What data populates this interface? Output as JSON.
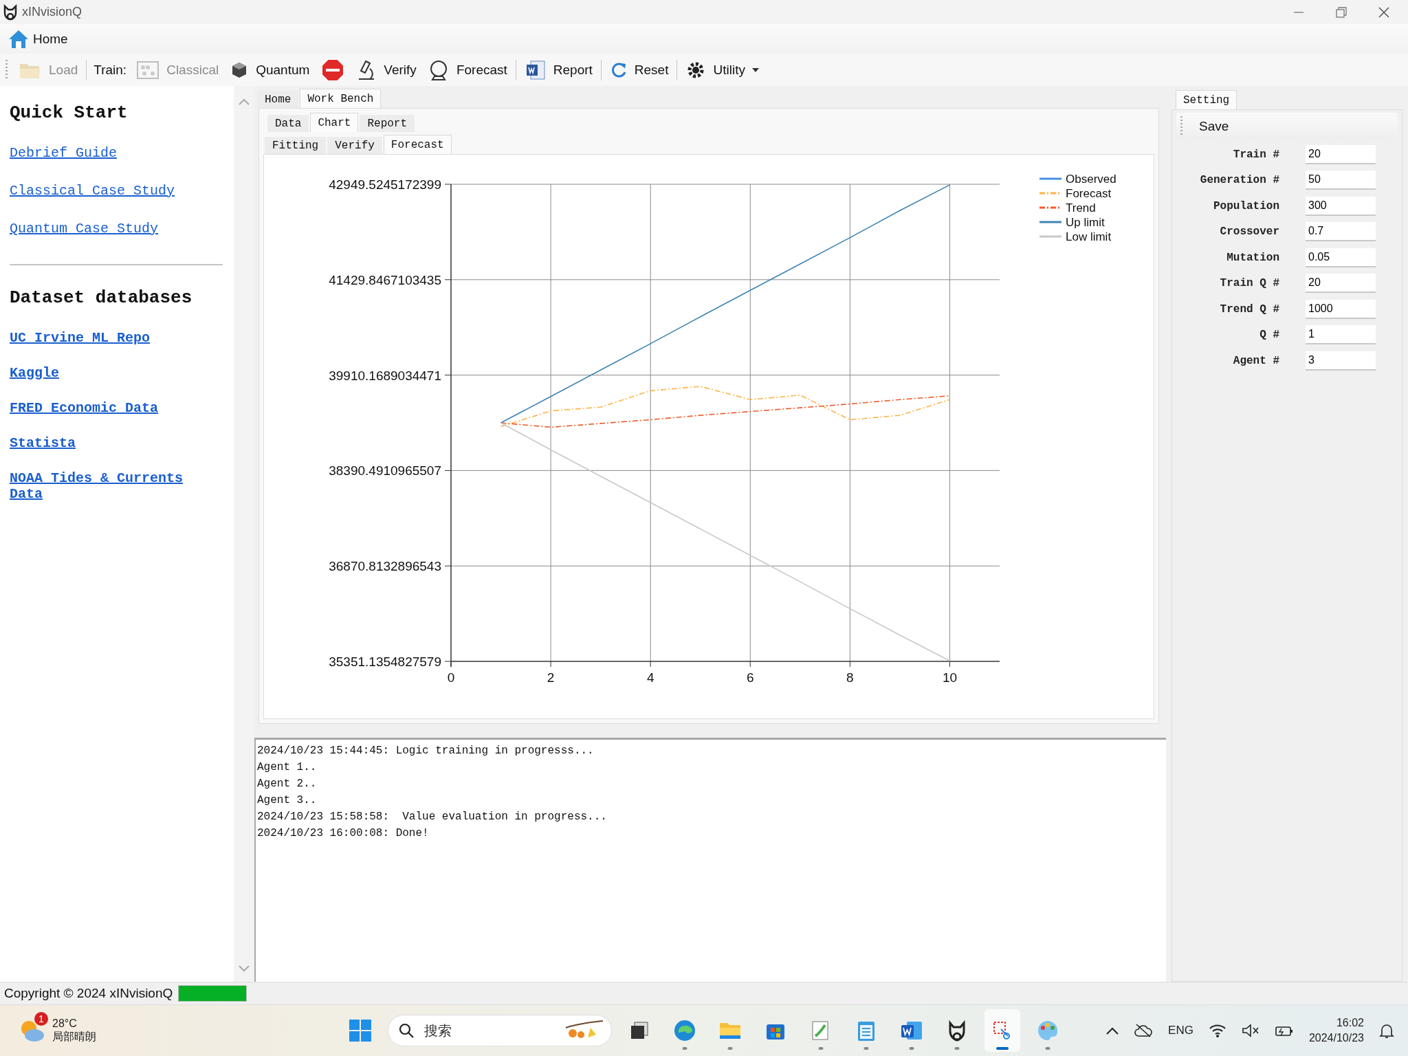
{
  "window": {
    "title": "xINvisionQ"
  },
  "menu": [
    {
      "label": "Home"
    }
  ],
  "toolbar": {
    "groups": [
      [
        {
          "kind": "button",
          "label": "Load",
          "disabled": true
        }
      ],
      [
        {
          "kind": "label",
          "label": "Train:"
        },
        {
          "kind": "button",
          "label": "Classical",
          "disabled": true
        },
        {
          "kind": "button",
          "label": "Quantum",
          "disabled": false
        },
        {
          "kind": "icon_button",
          "disabled": false
        },
        {
          "kind": "button",
          "label": "Verify",
          "disabled": false
        },
        {
          "kind": "button",
          "label": "Forecast",
          "disabled": false
        }
      ],
      [
        {
          "kind": "button",
          "label": "Report",
          "disabled": false
        }
      ],
      [
        {
          "kind": "button",
          "label": "Reset",
          "disabled": false
        }
      ],
      [
        {
          "kind": "dropdown",
          "label": "Utility",
          "disabled": false
        }
      ]
    ]
  },
  "sidebar": {
    "sections": [
      {
        "heading": "Quick Start",
        "kind": "plain",
        "links": [
          {
            "label": "Debrief Guide"
          },
          {
            "label": "Classical Case Study"
          },
          {
            "label": "Quantum Case Study"
          }
        ]
      },
      {
        "heading": "Dataset databases",
        "kind": "bold",
        "links": [
          {
            "label": "UC Irvine ML Repo"
          },
          {
            "label": "Kaggle"
          },
          {
            "label": "FRED Economic Data"
          },
          {
            "label": "Statista"
          },
          {
            "label": "NOAA Tides & Currents Data"
          }
        ]
      }
    ]
  },
  "workbench": {
    "tabs": [
      {
        "label": "Home",
        "selected": false
      },
      {
        "label": "Work Bench",
        "selected": true
      }
    ],
    "subtabs": [
      {
        "label": "Data",
        "selected": false
      },
      {
        "label": "Chart",
        "selected": true
      },
      {
        "label": "Report",
        "selected": false
      }
    ],
    "chart_tabs": [
      {
        "label": "Fitting",
        "selected": false
      },
      {
        "label": "Verify",
        "selected": false
      },
      {
        "label": "Forecast",
        "selected": true
      }
    ],
    "chart": {
      "chart_data": {
        "type": "line",
        "grid": true,
        "legend": true,
        "x": [
          1,
          2,
          3,
          4,
          5,
          6,
          7,
          8,
          9,
          10
        ],
        "xlim": [
          0,
          11
        ],
        "ylim": [
          35351.1354827579,
          42949.5245172399
        ],
        "xticks": [
          0,
          2,
          4,
          6,
          8,
          10
        ],
        "yticks": [
          {
            "value": 35351.1354827579,
            "label": "35351.1354827579"
          },
          {
            "value": 36870.8132896543,
            "label": "36870.8132896543"
          },
          {
            "value": 38390.4910965507,
            "label": "38390.4910965507"
          },
          {
            "value": 39910.1689034471,
            "label": "39910.1689034471"
          },
          {
            "value": 41429.8467103435,
            "label": "41429.8467103435"
          },
          {
            "value": 42949.5245172399,
            "label": "42949.5245172399"
          }
        ],
        "series": [
          {
            "name": "Observed",
            "color": "#4a8fe6",
            "line_style": "solid",
            "values": [
              null,
              null,
              null,
              null,
              null,
              null,
              null,
              null,
              null,
              null
            ]
          },
          {
            "name": "Forecast",
            "color": "#ffb347",
            "line_style": "dashdot",
            "values": [
              39090,
              39340,
              39400,
              39660,
              39730,
              39520,
              39590,
              39200,
              39270,
              39520
            ]
          },
          {
            "name": "Trend",
            "color": "#f05a28",
            "line_style": "dashdot",
            "values": [
              39150,
              39080,
              39140,
              39200,
              39270,
              39330,
              39390,
              39450,
              39520,
              39580
            ]
          },
          {
            "name": "Up limit",
            "color": "#3d85b5",
            "line_style": "solid",
            "values": [
              39150,
              39570,
              39990,
              40410,
              40840,
              41260,
              41680,
              42100,
              42530,
              42940
            ]
          },
          {
            "name": "Low limit",
            "color": "#c8c8c8",
            "line_style": "solid",
            "values": [
              39150,
              38720,
              38300,
              37880,
              37460,
              37040,
              36620,
              36190,
              35770,
              35360
            ]
          }
        ]
      }
    }
  },
  "log": {
    "lines": [
      "2024/10/23 15:44:45: Logic training in progresss...",
      "Agent 1..",
      "Agent 2..",
      "Agent 3..",
      "2024/10/23 15:58:58:  Value evaluation in progress...",
      "2024/10/23 16:00:08: Done!"
    ]
  },
  "settings": {
    "tabs": [
      {
        "label": "Setting",
        "selected": true
      }
    ],
    "save": "Save",
    "fields": [
      {
        "label": "Train #",
        "value": "20"
      },
      {
        "label": "Generation #",
        "value": "50"
      },
      {
        "label": "Population",
        "value": "300"
      },
      {
        "label": "Crossover",
        "value": "0.7"
      },
      {
        "label": "Mutation",
        "value": "0.05"
      },
      {
        "label": "Train Q #",
        "value": "20"
      },
      {
        "label": "Trend Q #",
        "value": "1000"
      },
      {
        "label": "Q #",
        "value": "1"
      },
      {
        "label": "Agent #",
        "value": "3"
      }
    ]
  },
  "status_bar": {
    "text": "Copyright © 2024 xINvisionQ",
    "progress": {
      "level": 1
    }
  },
  "taskbar": {
    "weather": {
      "badge": "1",
      "temperature": "28°C",
      "condition": "局部晴朗"
    },
    "search": {
      "placeholder": "搜索"
    },
    "apps": [
      {
        "running": false,
        "selected": false
      },
      {
        "running": true,
        "selected": false
      },
      {
        "running": true,
        "selected": false
      },
      {
        "running": false,
        "selected": false
      },
      {
        "running": true,
        "selected": false
      },
      {
        "running": true,
        "selected": false
      },
      {
        "running": true,
        "selected": false
      },
      {
        "running": true,
        "selected": false
      },
      {
        "running": true,
        "selected": true
      },
      {
        "running": true,
        "selected": false
      }
    ],
    "tray": {
      "language": "ENG",
      "time": "16:02",
      "date": "2024/10/23"
    }
  }
}
